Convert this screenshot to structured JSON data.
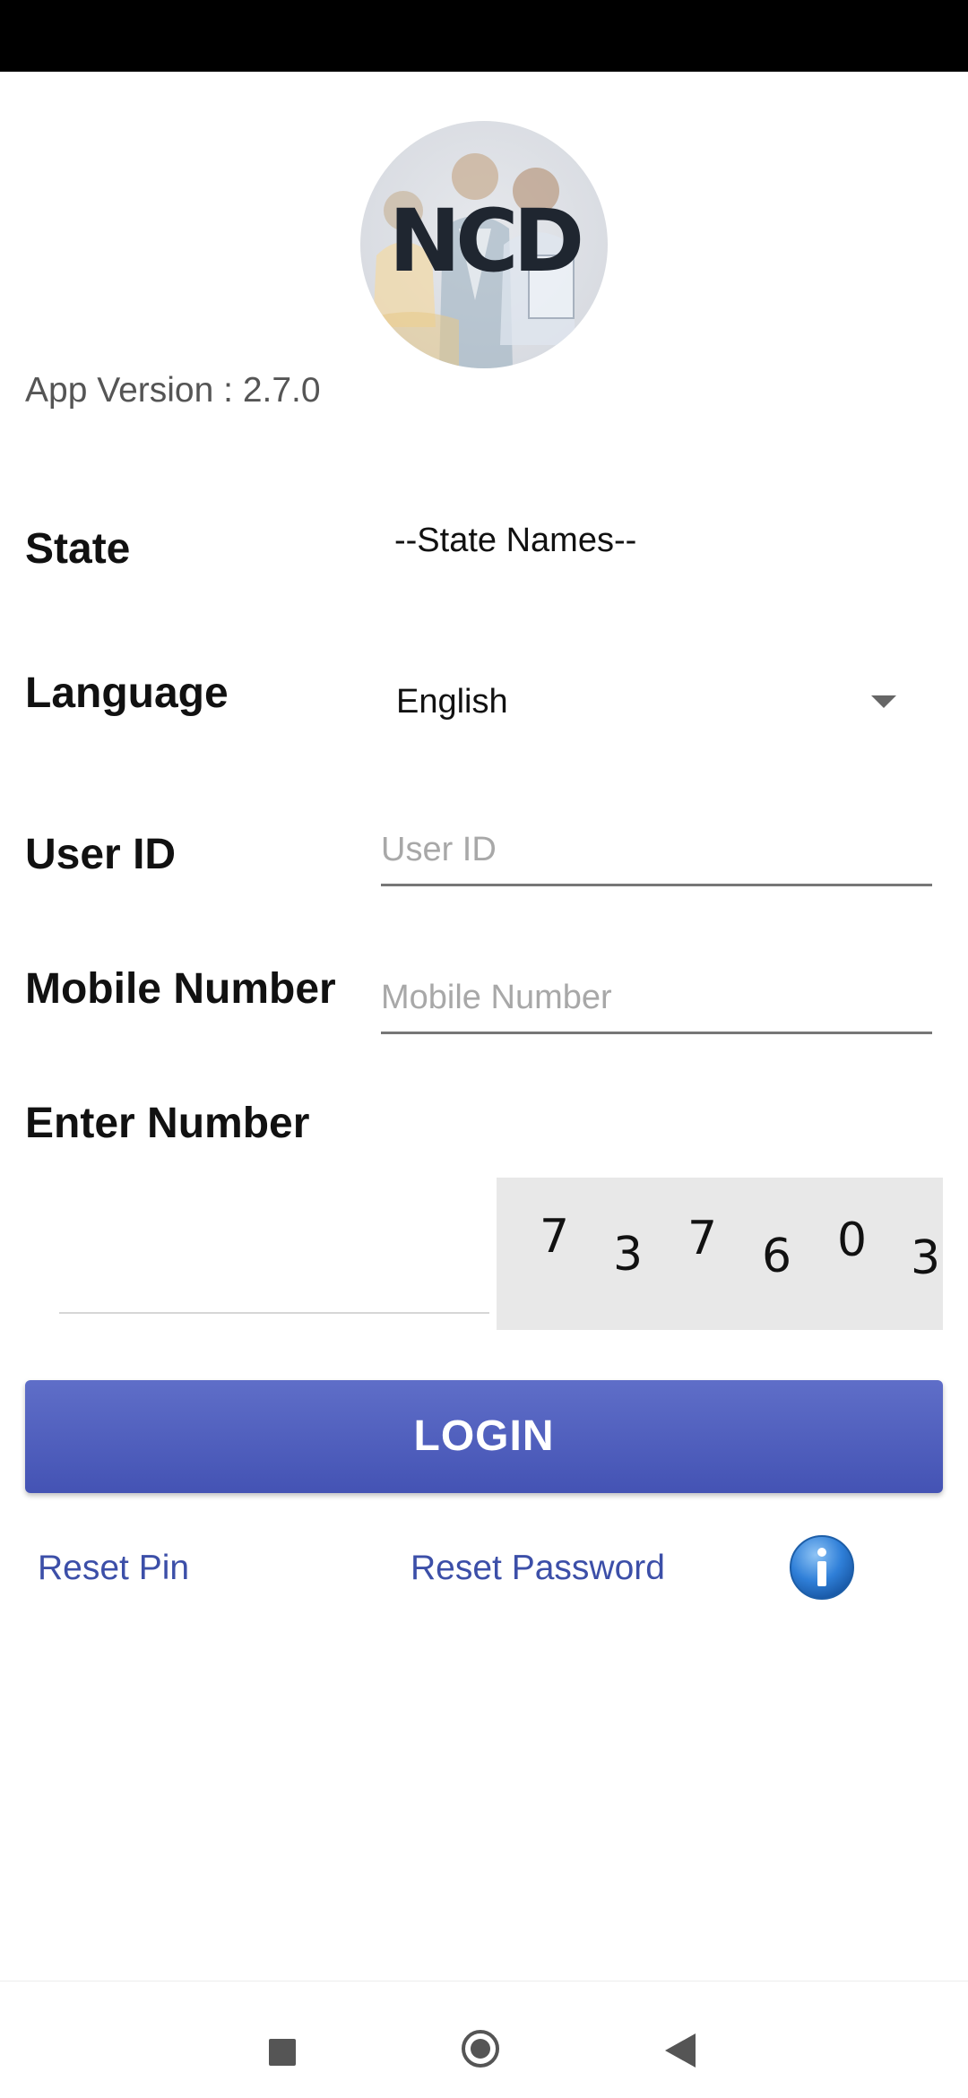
{
  "logo": {
    "text": "NCD"
  },
  "app_version": "App Version : 2.7.0",
  "form": {
    "state": {
      "label": "State",
      "value": "--State Names--"
    },
    "language": {
      "label": "Language",
      "value": "English"
    },
    "user_id": {
      "label": "User ID",
      "placeholder": "User ID",
      "value": ""
    },
    "mobile": {
      "label": "Mobile Number",
      "placeholder": "Mobile Number",
      "value": ""
    },
    "captcha": {
      "label": "Enter Number",
      "input_value": "",
      "digits": [
        "7",
        "3",
        "7",
        "6",
        "0",
        "3"
      ]
    }
  },
  "login_button": "LOGIN",
  "links": {
    "reset_pin": "Reset Pin",
    "reset_password": "Reset Password"
  },
  "colors": {
    "primary": "#4a59b9",
    "link": "#3c4fa8",
    "info_icon": "#2f7fd8",
    "captcha_bg": "#e8e8e8"
  },
  "icons": {
    "info": "info-icon",
    "dropdown": "caret-down-icon",
    "nav_recents": "square-icon",
    "nav_home": "circle-icon",
    "nav_back": "triangle-back-icon"
  }
}
